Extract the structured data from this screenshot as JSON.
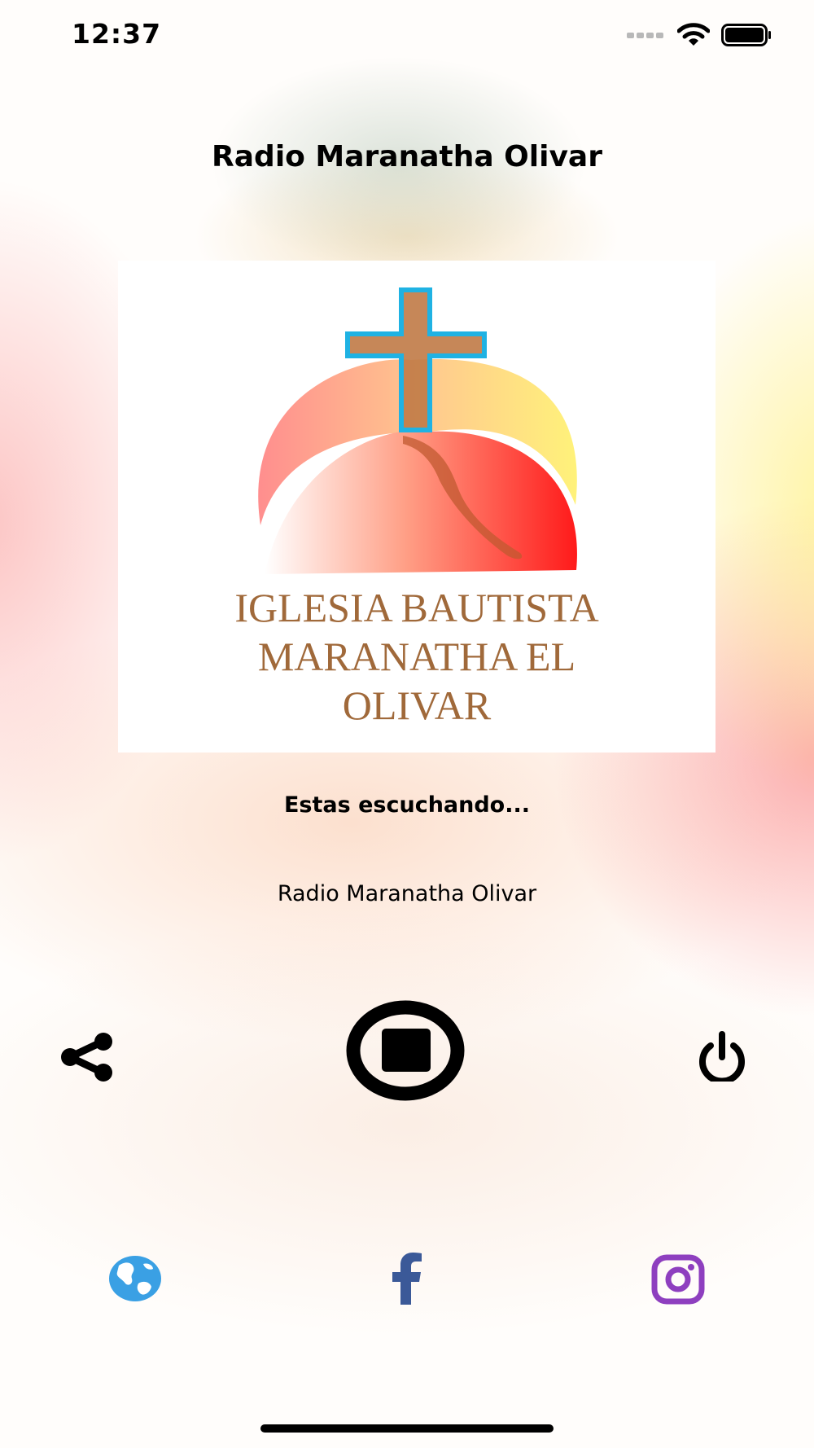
{
  "status_bar": {
    "time": "12:37",
    "icons": [
      "signal-icon",
      "wifi-icon",
      "battery-icon"
    ]
  },
  "header": {
    "title": "Radio Maranatha Olivar"
  },
  "artwork": {
    "lines": [
      "IGLESIA BAUTISTA",
      "MARANATHA EL",
      "OLIVAR"
    ],
    "colors": {
      "text": "#a0693a",
      "cross_fill": "#c07a46",
      "cross_outline": "#1fb2e3",
      "dome_left": "#ff8e8e",
      "dome_right": "#fff27a",
      "dome_base": "#ff1a1a"
    }
  },
  "now_playing": {
    "label": "Estas escuchando...",
    "station": "Radio Maranatha Olivar"
  },
  "controls": {
    "share": "share-icon",
    "stop": "stop-icon",
    "power": "power-icon"
  },
  "social": {
    "web": {
      "icon": "globe-icon",
      "color": "#3aa0e4"
    },
    "facebook": {
      "icon": "facebook-icon",
      "color": "#3b5998"
    },
    "instagram": {
      "icon": "instagram-icon",
      "color": "#8e3fbf"
    }
  }
}
